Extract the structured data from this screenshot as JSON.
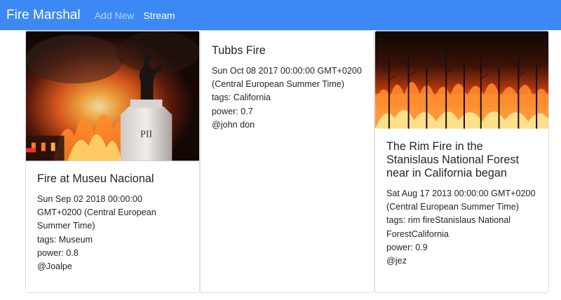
{
  "navbar": {
    "brand": "Fire Marshal",
    "links": [
      {
        "label": "Add New",
        "state": "inactive"
      },
      {
        "label": "Stream",
        "state": "active"
      }
    ],
    "background_color": "#3c89f5"
  },
  "cards": [
    {
      "title": "Fire at Museu Nacional",
      "date": "Sun Sep 02 2018 00:00:00 GMT+0200 (Central European Summer Time)",
      "tags": "tags: Museum",
      "power": "power: 0.8",
      "author": "@Joalpe",
      "image": "photo-statue-museum-fire"
    },
    {
      "title": "Tubbs Fire",
      "date": "Sun Oct 08 2017 00:00:00 GMT+0200 (Central European Summer Time)",
      "tags": "tags: California",
      "power": "power: 0.7",
      "author": "@john don"
    },
    {
      "title": "The Rim Fire in the Stanislaus National Forest near in California began",
      "date": "Sat Aug 17 2013 00:00:00 GMT+0200 (Central European Summer Time)",
      "tags": "tags: rim fireStanislaus National ForestCalifornia",
      "power": "power: 0.9",
      "author": "@jez",
      "image": "photo-forest-fire"
    }
  ]
}
